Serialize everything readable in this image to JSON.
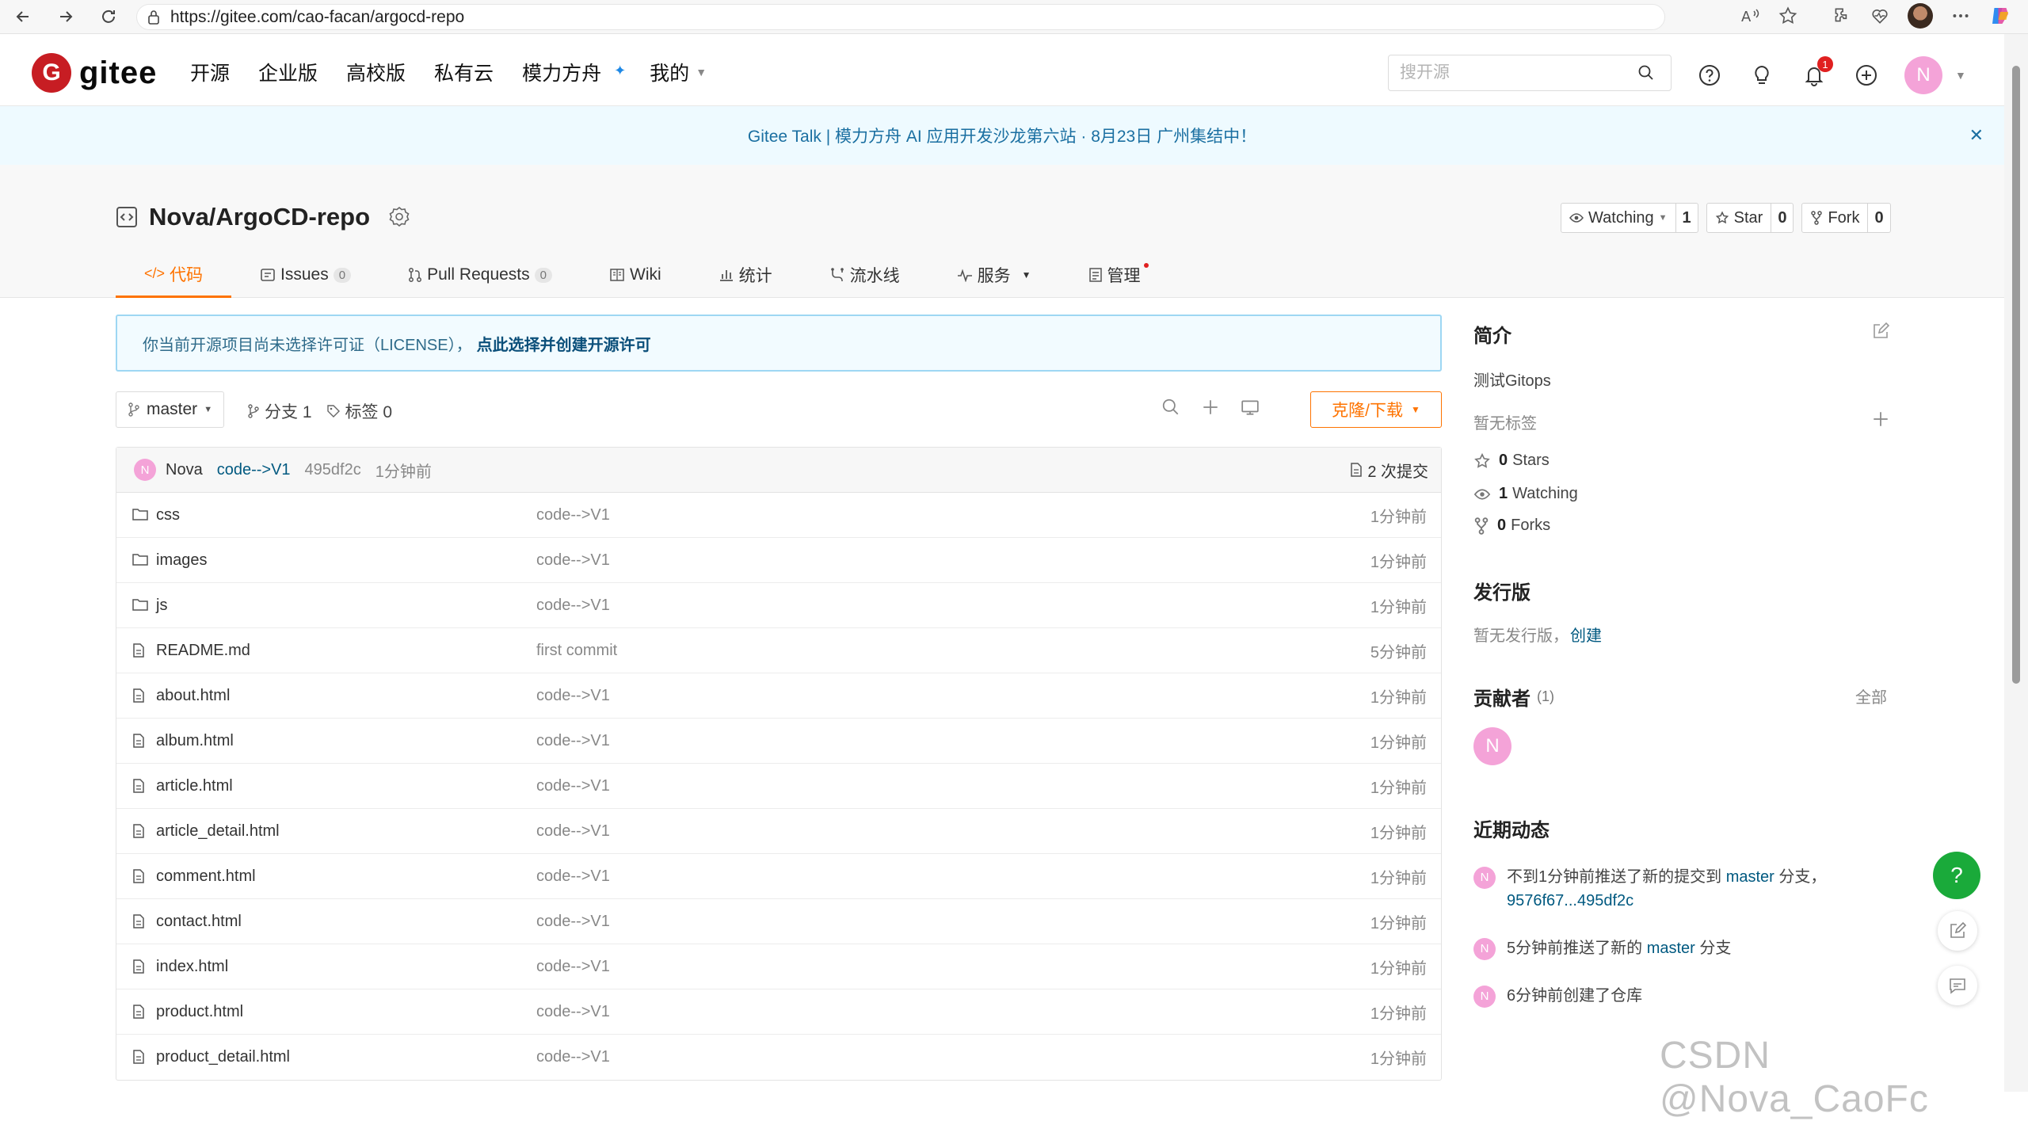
{
  "browser": {
    "url": "https://gitee.com/cao-facan/argocd-repo"
  },
  "header": {
    "logo_text": "gitee",
    "logo_mark": "G",
    "nav": [
      "开源",
      "企业版",
      "高校版",
      "私有云",
      "模力方舟",
      "我的"
    ],
    "search_placeholder": "搜开源",
    "notification_count": "1",
    "user_initial": "N"
  },
  "banner": {
    "text": "Gitee Talk | 模力方舟 AI 应用开发沙龙第六站 · 8月23日 广州集结中！",
    "close": "✕"
  },
  "repo": {
    "name": "Nova/ArgoCD-repo",
    "watch_label": "Watching",
    "watch_count": "1",
    "star_label": "Star",
    "star_count": "0",
    "fork_label": "Fork",
    "fork_count": "0",
    "tabs": [
      {
        "label": "代码"
      },
      {
        "label": "Issues",
        "badge": "0"
      },
      {
        "label": "Pull Requests",
        "badge": "0"
      },
      {
        "label": "Wiki"
      },
      {
        "label": "统计"
      },
      {
        "label": "流水线"
      },
      {
        "label": "服务"
      },
      {
        "label": "管理"
      }
    ]
  },
  "license": {
    "text": "你当前开源项目尚未选择许可证（LICENSE），",
    "link": "点此选择并创建开源许可"
  },
  "toolbar": {
    "branch": "master",
    "branches": "分支 1",
    "tags": "标签 0",
    "clone": "克隆/下载"
  },
  "commit": {
    "author_initial": "N",
    "author": "Nova",
    "message": "code-->V1",
    "sha": "495df2c",
    "time": "1分钟前",
    "count": "2 次提交"
  },
  "files": [
    {
      "name": "css",
      "type": "folder",
      "message": "code-->V1",
      "time": "1分钟前"
    },
    {
      "name": "images",
      "type": "folder",
      "message": "code-->V1",
      "time": "1分钟前"
    },
    {
      "name": "js",
      "type": "folder",
      "message": "code-->V1",
      "time": "1分钟前"
    },
    {
      "name": "README.md",
      "type": "file",
      "message": "first commit",
      "time": "5分钟前"
    },
    {
      "name": "about.html",
      "type": "file",
      "message": "code-->V1",
      "time": "1分钟前"
    },
    {
      "name": "album.html",
      "type": "file",
      "message": "code-->V1",
      "time": "1分钟前"
    },
    {
      "name": "article.html",
      "type": "file",
      "message": "code-->V1",
      "time": "1分钟前"
    },
    {
      "name": "article_detail.html",
      "type": "file",
      "message": "code-->V1",
      "time": "1分钟前"
    },
    {
      "name": "comment.html",
      "type": "file",
      "message": "code-->V1",
      "time": "1分钟前"
    },
    {
      "name": "contact.html",
      "type": "file",
      "message": "code-->V1",
      "time": "1分钟前"
    },
    {
      "name": "index.html",
      "type": "file",
      "message": "code-->V1",
      "time": "1分钟前"
    },
    {
      "name": "product.html",
      "type": "file",
      "message": "code-->V1",
      "time": "1分钟前"
    },
    {
      "name": "product_detail.html",
      "type": "file",
      "message": "code-->V1",
      "time": "1分钟前"
    }
  ],
  "sidebar": {
    "intro_title": "简介",
    "description": "测试Gitops",
    "no_tags": "暂无标签",
    "stars_count": "0",
    "stars_label": "Stars",
    "watching_count": "1",
    "watching_label": "Watching",
    "forks_count": "0",
    "forks_label": "Forks",
    "release_title": "发行版",
    "no_release": "暂无发行版，",
    "create": "创建",
    "contributors_title": "贡献者",
    "contributors_count": "(1)",
    "all": "全部",
    "contributor_initial": "N",
    "activity_title": "近期动态",
    "activities": [
      {
        "before": "不到1分钟前推送了新的提交到 ",
        "branch": "master",
        "middle": " 分支，",
        "range": "9576f67...495df2c"
      },
      {
        "before": "5分钟前推送了新的 ",
        "branch": "master",
        "middle": " 分支",
        "range": ""
      },
      {
        "before": "6分钟前创建了仓库",
        "branch": "",
        "middle": "",
        "range": ""
      }
    ]
  },
  "float": {
    "help": "?"
  },
  "watermark": "CSDN @Nova_CaoFc",
  "colors": {
    "accent": "#fe7300",
    "brand": "#c71d23",
    "link": "#005980",
    "avatar": "#f4a3d8"
  }
}
